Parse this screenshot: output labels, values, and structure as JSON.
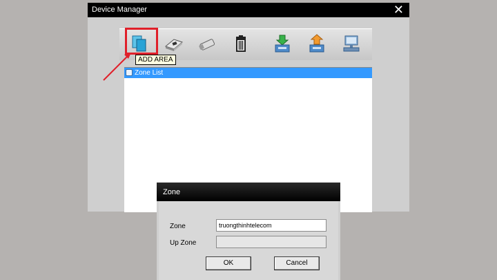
{
  "window": {
    "title": "Device Manager",
    "close_glyph": "✕"
  },
  "toolbar": {
    "buttons": [
      {
        "name": "add-area-icon",
        "active": true
      },
      {
        "name": "add-device-icon"
      },
      {
        "name": "usb-drive-icon"
      },
      {
        "name": "trash-icon"
      },
      {
        "name": "import-icon"
      },
      {
        "name": "export-icon"
      },
      {
        "name": "network-device-icon"
      }
    ],
    "tooltip": "ADD AREA"
  },
  "tree": {
    "items": [
      {
        "label": "Zone List",
        "selected": true
      }
    ]
  },
  "zone_dialog": {
    "title": "Zone",
    "zone_label": "Zone",
    "zone_value": "truongthinhtelecom",
    "up_zone_label": "Up Zone",
    "up_zone_value": "",
    "ok_label": "OK",
    "cancel_label": "Cancel"
  },
  "colors": {
    "highlight": "#e0202a",
    "selection": "#3399ff"
  }
}
